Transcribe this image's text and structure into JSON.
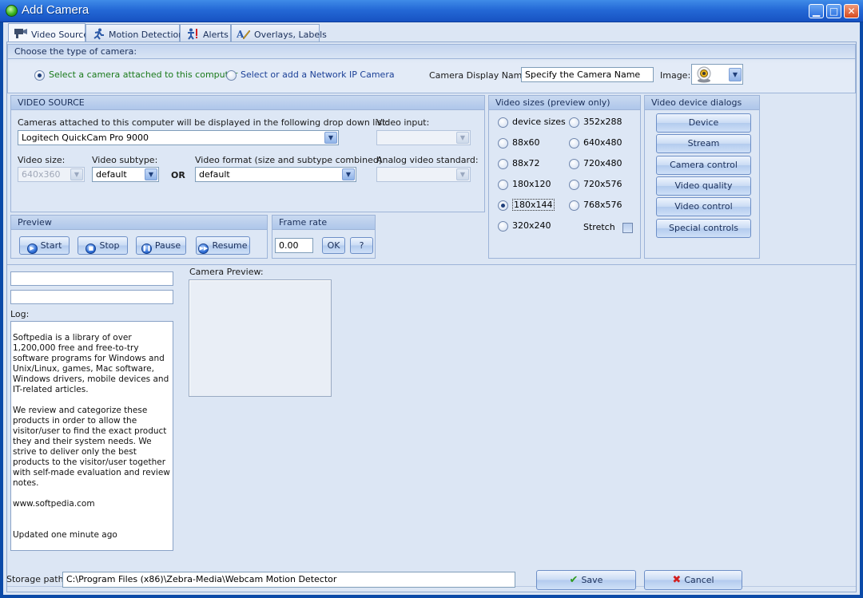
{
  "window": {
    "title": "Add Camera",
    "minimize": "▁",
    "maximize": "□",
    "close": "✕"
  },
  "tabs": [
    {
      "label": "Video Source",
      "icon": "camera-icon"
    },
    {
      "label": "Motion Detection",
      "icon": "running-man-icon"
    },
    {
      "label": "Alerts",
      "icon": "alert-figure-icon"
    },
    {
      "label": "Overlays, Labels",
      "icon": "pen-icon"
    }
  ],
  "camera_type": {
    "heading": "Choose the type of camera:",
    "option_local": "Select a camera attached to this computer",
    "option_network": "Select or add a Network IP Camera",
    "display_name_label": "Camera Display Name:",
    "display_name_value": "Specify the Camera Name",
    "image_label": "Image:"
  },
  "video_source": {
    "heading": "VIDEO SOURCE",
    "cameras_label": "Cameras attached to this computer will be displayed in the following drop down list:",
    "camera_value": "Logitech QuickCam Pro 9000",
    "video_input_label": "Video input:",
    "video_input_value": "",
    "video_size_label": "Video size:",
    "video_size_value": "640x360",
    "video_subtype_label": "Video subtype:",
    "video_subtype_value": "default",
    "or_label": "OR",
    "video_format_label": "Video format (size and subtype combined)",
    "video_format_value": "default",
    "analog_label": "Analog video standard:",
    "analog_value": ""
  },
  "preview": {
    "heading": "Preview",
    "start": "Start",
    "stop": "Stop",
    "pause": "Pause",
    "resume": "Resume"
  },
  "frame_rate": {
    "heading": "Frame rate",
    "value": "0.00",
    "ok": "OK",
    "help": "?"
  },
  "video_sizes": {
    "heading": "Video sizes (preview only)",
    "left": [
      "device sizes",
      "88x60",
      "88x72",
      "180x120",
      "180x144",
      "320x240"
    ],
    "right": [
      "352x288",
      "640x480",
      "720x480",
      "720x576",
      "768x576"
    ],
    "selected": "180x144",
    "stretch_label": "Stretch"
  },
  "device_dialogs": {
    "heading": "Video device dialogs",
    "buttons": [
      "Device",
      "Stream",
      "Camera control",
      "Video quality",
      "Video control",
      "Special controls"
    ]
  },
  "log": {
    "label": "Log:",
    "paragraphs": [
      "Softpedia is a library of over 1,200,000 free and free-to-try software programs for Windows and Unix/Linux, games, Mac software, Windows drivers, mobile devices and IT-related articles.",
      "We review and categorize these products in order to allow the visitor/user to find the exact product they and their system needs. We strive to deliver only the best products to the visitor/user together with self-made evaluation and review notes.",
      "www.softpedia.com",
      "Updated one minute ago"
    ]
  },
  "camera_preview": {
    "label": "Camera Preview:"
  },
  "footer": {
    "storage_label": "Storage path:",
    "storage_value": "C:\\Program Files (x86)\\Zebra-Media\\Webcam Motion Detector",
    "save": "Save",
    "cancel": "Cancel"
  },
  "colors": {
    "titlebar": "#2469d6",
    "client": "#dce6f4",
    "accent_text": "#1a2f5a",
    "save_check": "#2e9b1e",
    "cancel_x": "#d21f1f"
  }
}
